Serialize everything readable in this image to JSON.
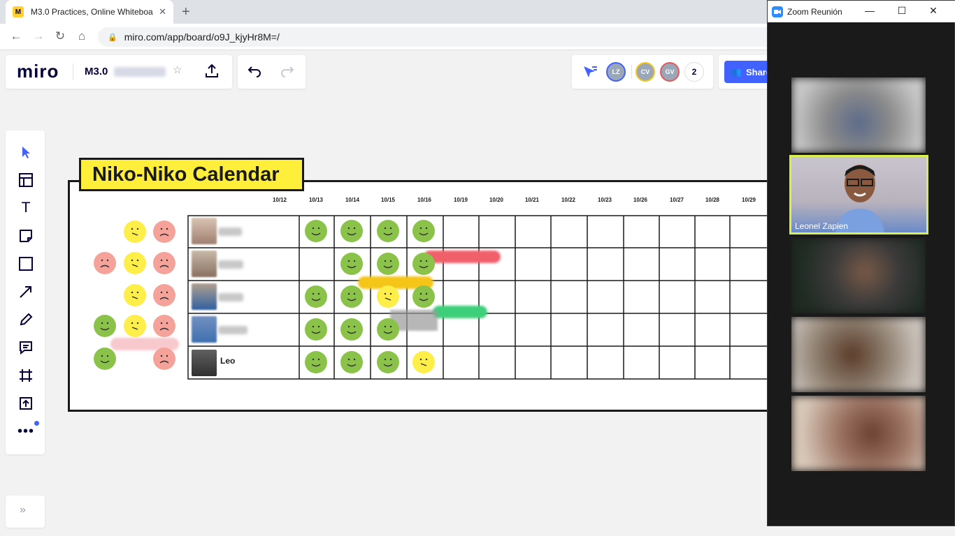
{
  "browser": {
    "tab_title": "M3.0 Practices, Online Whiteboar",
    "tab_favicon": "M",
    "url": "miro.com/app/board/o9J_kjyHr8M=/"
  },
  "miro": {
    "logo": "miro",
    "board_title": "M3.0",
    "avatars": [
      {
        "initials": "LZ",
        "color": "#9aa7b8",
        "ring": "#4262ff"
      },
      {
        "initials": "CV",
        "color": "#9aa7b8",
        "ring": "#f5c518"
      },
      {
        "initials": "GV",
        "color": "#9aa7b8",
        "ring": "#e35a5a"
      }
    ],
    "extra_count": "2",
    "share_label": "Share",
    "expand_label": "»"
  },
  "calendar": {
    "title": "Niko-Niko Calendar",
    "dates": [
      "10/12",
      "10/13",
      "10/14",
      "10/15",
      "10/16",
      "10/19",
      "10/20",
      "10/21",
      "10/22",
      "10/23",
      "10/26",
      "10/27",
      "10/28",
      "10/29"
    ],
    "rows": [
      {
        "name": "",
        "moods": [
          "happy",
          "happy",
          "happy",
          "happy"
        ]
      },
      {
        "name": "",
        "moods": [
          "",
          "happy",
          "happy",
          "happy"
        ]
      },
      {
        "name": "",
        "moods": [
          "happy",
          "happy",
          "neutral",
          "happy"
        ]
      },
      {
        "name": "",
        "moods": [
          "happy",
          "happy",
          "happy",
          ""
        ]
      },
      {
        "name": "Leo",
        "moods": [
          "happy",
          "happy",
          "happy",
          "neutral"
        ]
      }
    ],
    "colors": {
      "happy": "#8bc34a",
      "neutral": "#fdee4a",
      "sad": "#f4a29a"
    }
  },
  "zoom": {
    "title": "Zoom Reunión",
    "participants": [
      {
        "name": "",
        "active": false
      },
      {
        "name": "Leonel Zapien",
        "active": true
      },
      {
        "name": "",
        "active": false
      },
      {
        "name": "",
        "active": false
      },
      {
        "name": "",
        "active": false
      }
    ]
  }
}
